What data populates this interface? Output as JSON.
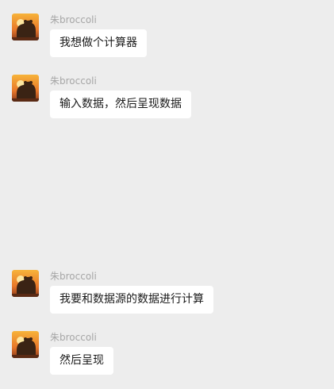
{
  "chat": {
    "messages": [
      {
        "sender": "朱broccoli",
        "text": "我想做个计算器",
        "avatar_icon": "bear-sunset-avatar"
      },
      {
        "sender": "朱broccoli",
        "text": "输入数据，然后呈现数据",
        "avatar_icon": "bear-sunset-avatar"
      },
      {
        "sender": "朱broccoli",
        "text": "我要和数据源的数据进行计算",
        "avatar_icon": "bear-sunset-avatar"
      },
      {
        "sender": "朱broccoli",
        "text": "然后呈现",
        "avatar_icon": "bear-sunset-avatar"
      }
    ]
  },
  "colors": {
    "background": "#ededed",
    "bubble": "#ffffff",
    "name_text": "#a6a6a6",
    "message_text": "#1a1a1a"
  }
}
